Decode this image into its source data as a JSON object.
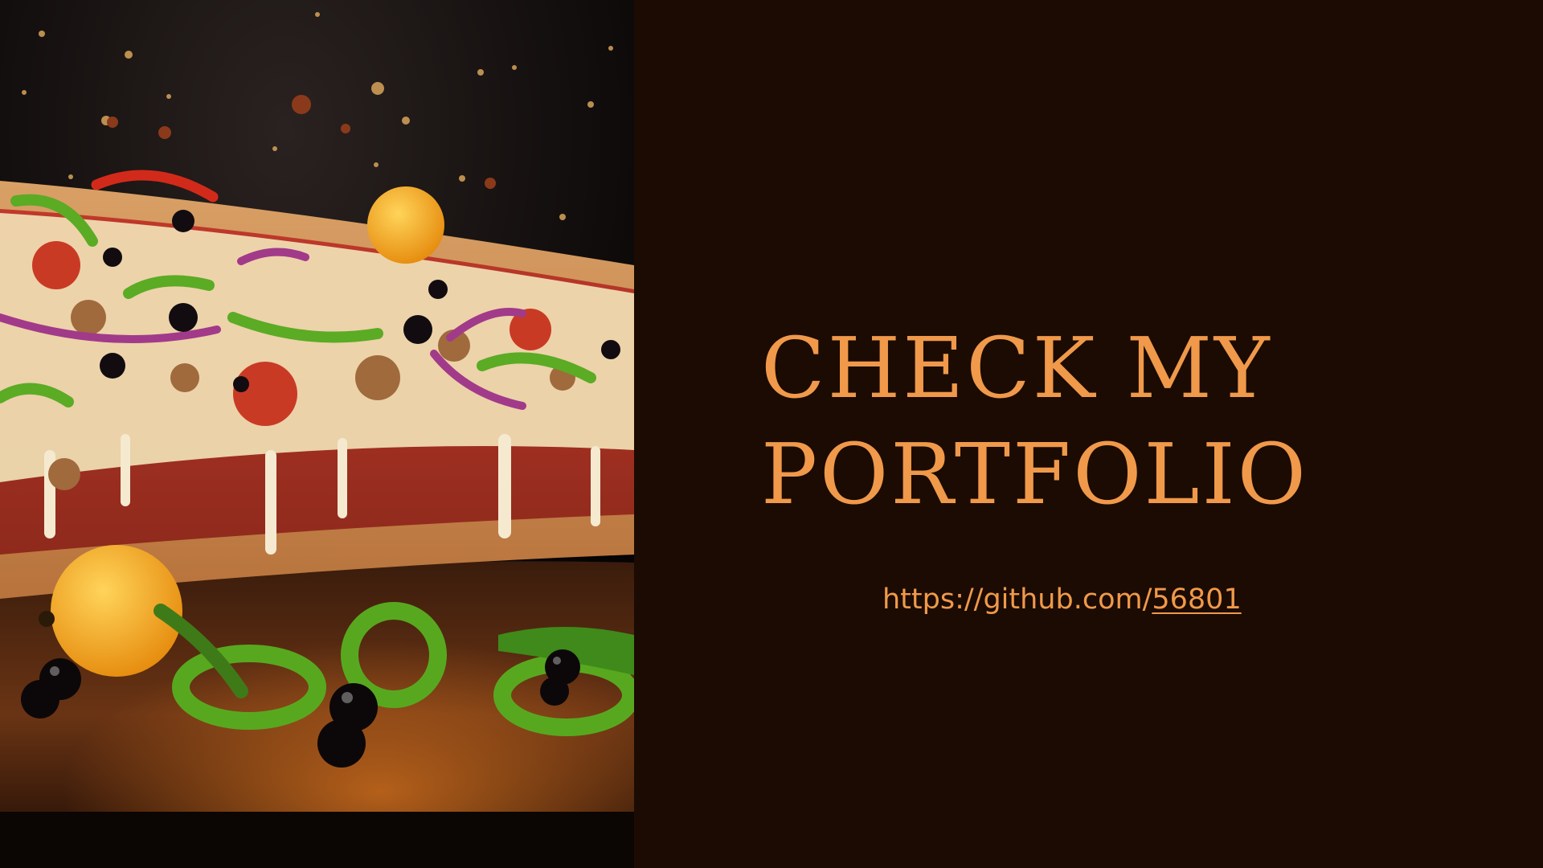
{
  "slide": {
    "headline_line1": "Check my",
    "headline_line2": "portfolio",
    "link_prefix": "https://github.com/",
    "link_suffix": "56801"
  },
  "colors": {
    "background": "#1b0b03",
    "accent": "#f0994a"
  },
  "image": {
    "subject": "pizza-photo"
  }
}
